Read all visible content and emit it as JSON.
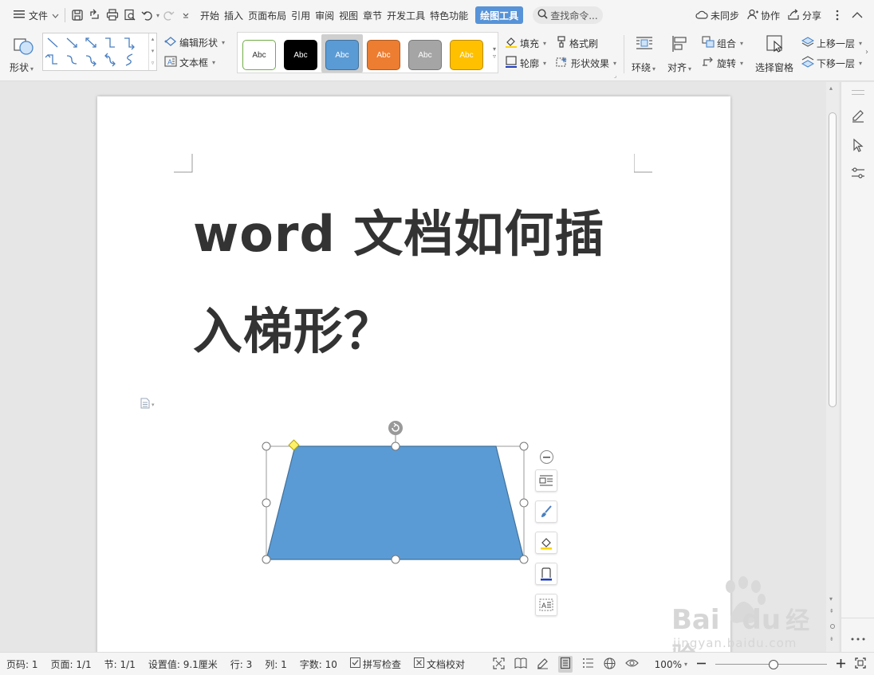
{
  "menubar": {
    "file_label": "文件",
    "tabs": [
      "开始",
      "插入",
      "页面布局",
      "引用",
      "审阅",
      "视图",
      "章节",
      "开发工具",
      "特色功能"
    ],
    "active_tab": "绘图工具",
    "search_placeholder": "查找命令...",
    "not_synced": "未同步",
    "collaborate": "协作",
    "share": "分享"
  },
  "ribbon": {
    "shape_label": "形状",
    "edit_shape": "编辑形状",
    "text_box": "文本框",
    "style_swatch_text": "Abc",
    "swatches": [
      {
        "bg": "#ffffff",
        "border": "#70ad47",
        "fg": "#333333"
      },
      {
        "bg": "#000000",
        "border": "#000000",
        "fg": "#ffffff"
      },
      {
        "bg": "#5b9bd5",
        "border": "#41719c",
        "fg": "#ffffff"
      },
      {
        "bg": "#ed7d31",
        "border": "#ae5a21",
        "fg": "#ffffff"
      },
      {
        "bg": "#a5a5a5",
        "border": "#787878",
        "fg": "#ffffff"
      },
      {
        "bg": "#ffc000",
        "border": "#bc8c00",
        "fg": "#ffffff"
      }
    ],
    "fill": "填充",
    "format_painter": "格式刷",
    "outline": "轮廓",
    "shape_effects": "形状效果",
    "wrap": "环绕",
    "align": "对齐",
    "group": "组合",
    "rotate": "旋转",
    "selection_pane": "选择窗格",
    "bring_forward": "上移一层",
    "send_backward": "下移一层"
  },
  "document": {
    "title_line1": "word 文档如何插",
    "title_line2": "入梯形？",
    "shape_fill": "#5b9bd5",
    "shape_stroke": "#41719c"
  },
  "statusbar": {
    "page_num": "页码: 1",
    "pages": "页面: 1/1",
    "section": "节: 1/1",
    "setting": "设置值: 9.1厘米",
    "row": "行: 3",
    "col": "列: 1",
    "word_count": "字数: 10",
    "spell_check": "拼写检查",
    "doc_proof": "文档校对",
    "zoom": "100%",
    "zoom_fraction": 0.52
  },
  "watermark": {
    "brand": "Bai",
    "brand2": "du",
    "brand_cn": "经验",
    "url": "jingyan.baidu.com"
  }
}
